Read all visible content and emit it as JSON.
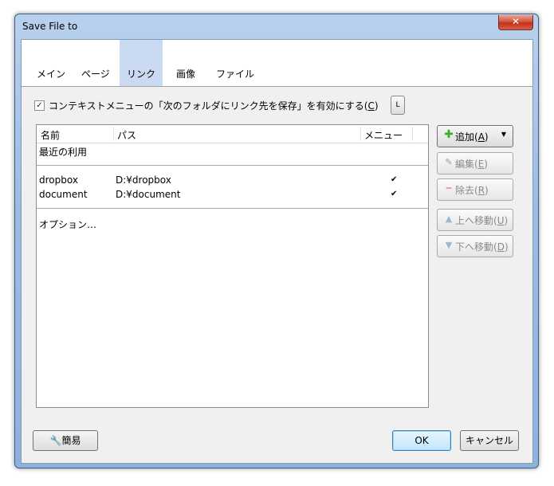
{
  "window": {
    "title": "Save File to",
    "close_glyph": "✕"
  },
  "tabs": [
    {
      "label": "メイン",
      "active": false
    },
    {
      "label": "ページ",
      "active": false
    },
    {
      "label": "リンク",
      "active": true
    },
    {
      "label": "画像",
      "active": false
    },
    {
      "label": "ファイル",
      "active": false
    }
  ],
  "option": {
    "checked": true,
    "label_prefix": "コンテキストメニューの「次のフォルダにリンク先を保存」を有効にする(",
    "accel": "C",
    "label_suffix": ")",
    "side_button": "L"
  },
  "list": {
    "columns": [
      "名前",
      "パス",
      "メニュー"
    ],
    "recent_label": "最近の利用",
    "rows": [
      {
        "name": "dropbox",
        "path": "D:¥dropbox",
        "menu": "✔"
      },
      {
        "name": "document",
        "path": "D:¥document",
        "menu": "✔"
      }
    ],
    "options_label": "オプション…"
  },
  "side_buttons": {
    "add": {
      "label": "追加(",
      "accel": "A",
      "suffix": ")",
      "enabled": true
    },
    "edit": {
      "label": "編集(",
      "accel": "E",
      "suffix": ")",
      "enabled": false
    },
    "remove": {
      "label": "除去(",
      "accel": "R",
      "suffix": ")",
      "enabled": false
    },
    "up": {
      "label": "上へ移動(",
      "accel": "U",
      "suffix": ")",
      "enabled": false
    },
    "down": {
      "label": "下へ移動(",
      "accel": "D",
      "suffix": ")",
      "enabled": false
    }
  },
  "footer": {
    "simple_label": "簡易",
    "ok_label": "OK",
    "cancel_label": "キャンセル"
  },
  "colors": {
    "active_tab": "#c9daf2",
    "titlebar": "#9fbde3",
    "close": "#c5301a",
    "add_icon": "#3cae2c"
  }
}
